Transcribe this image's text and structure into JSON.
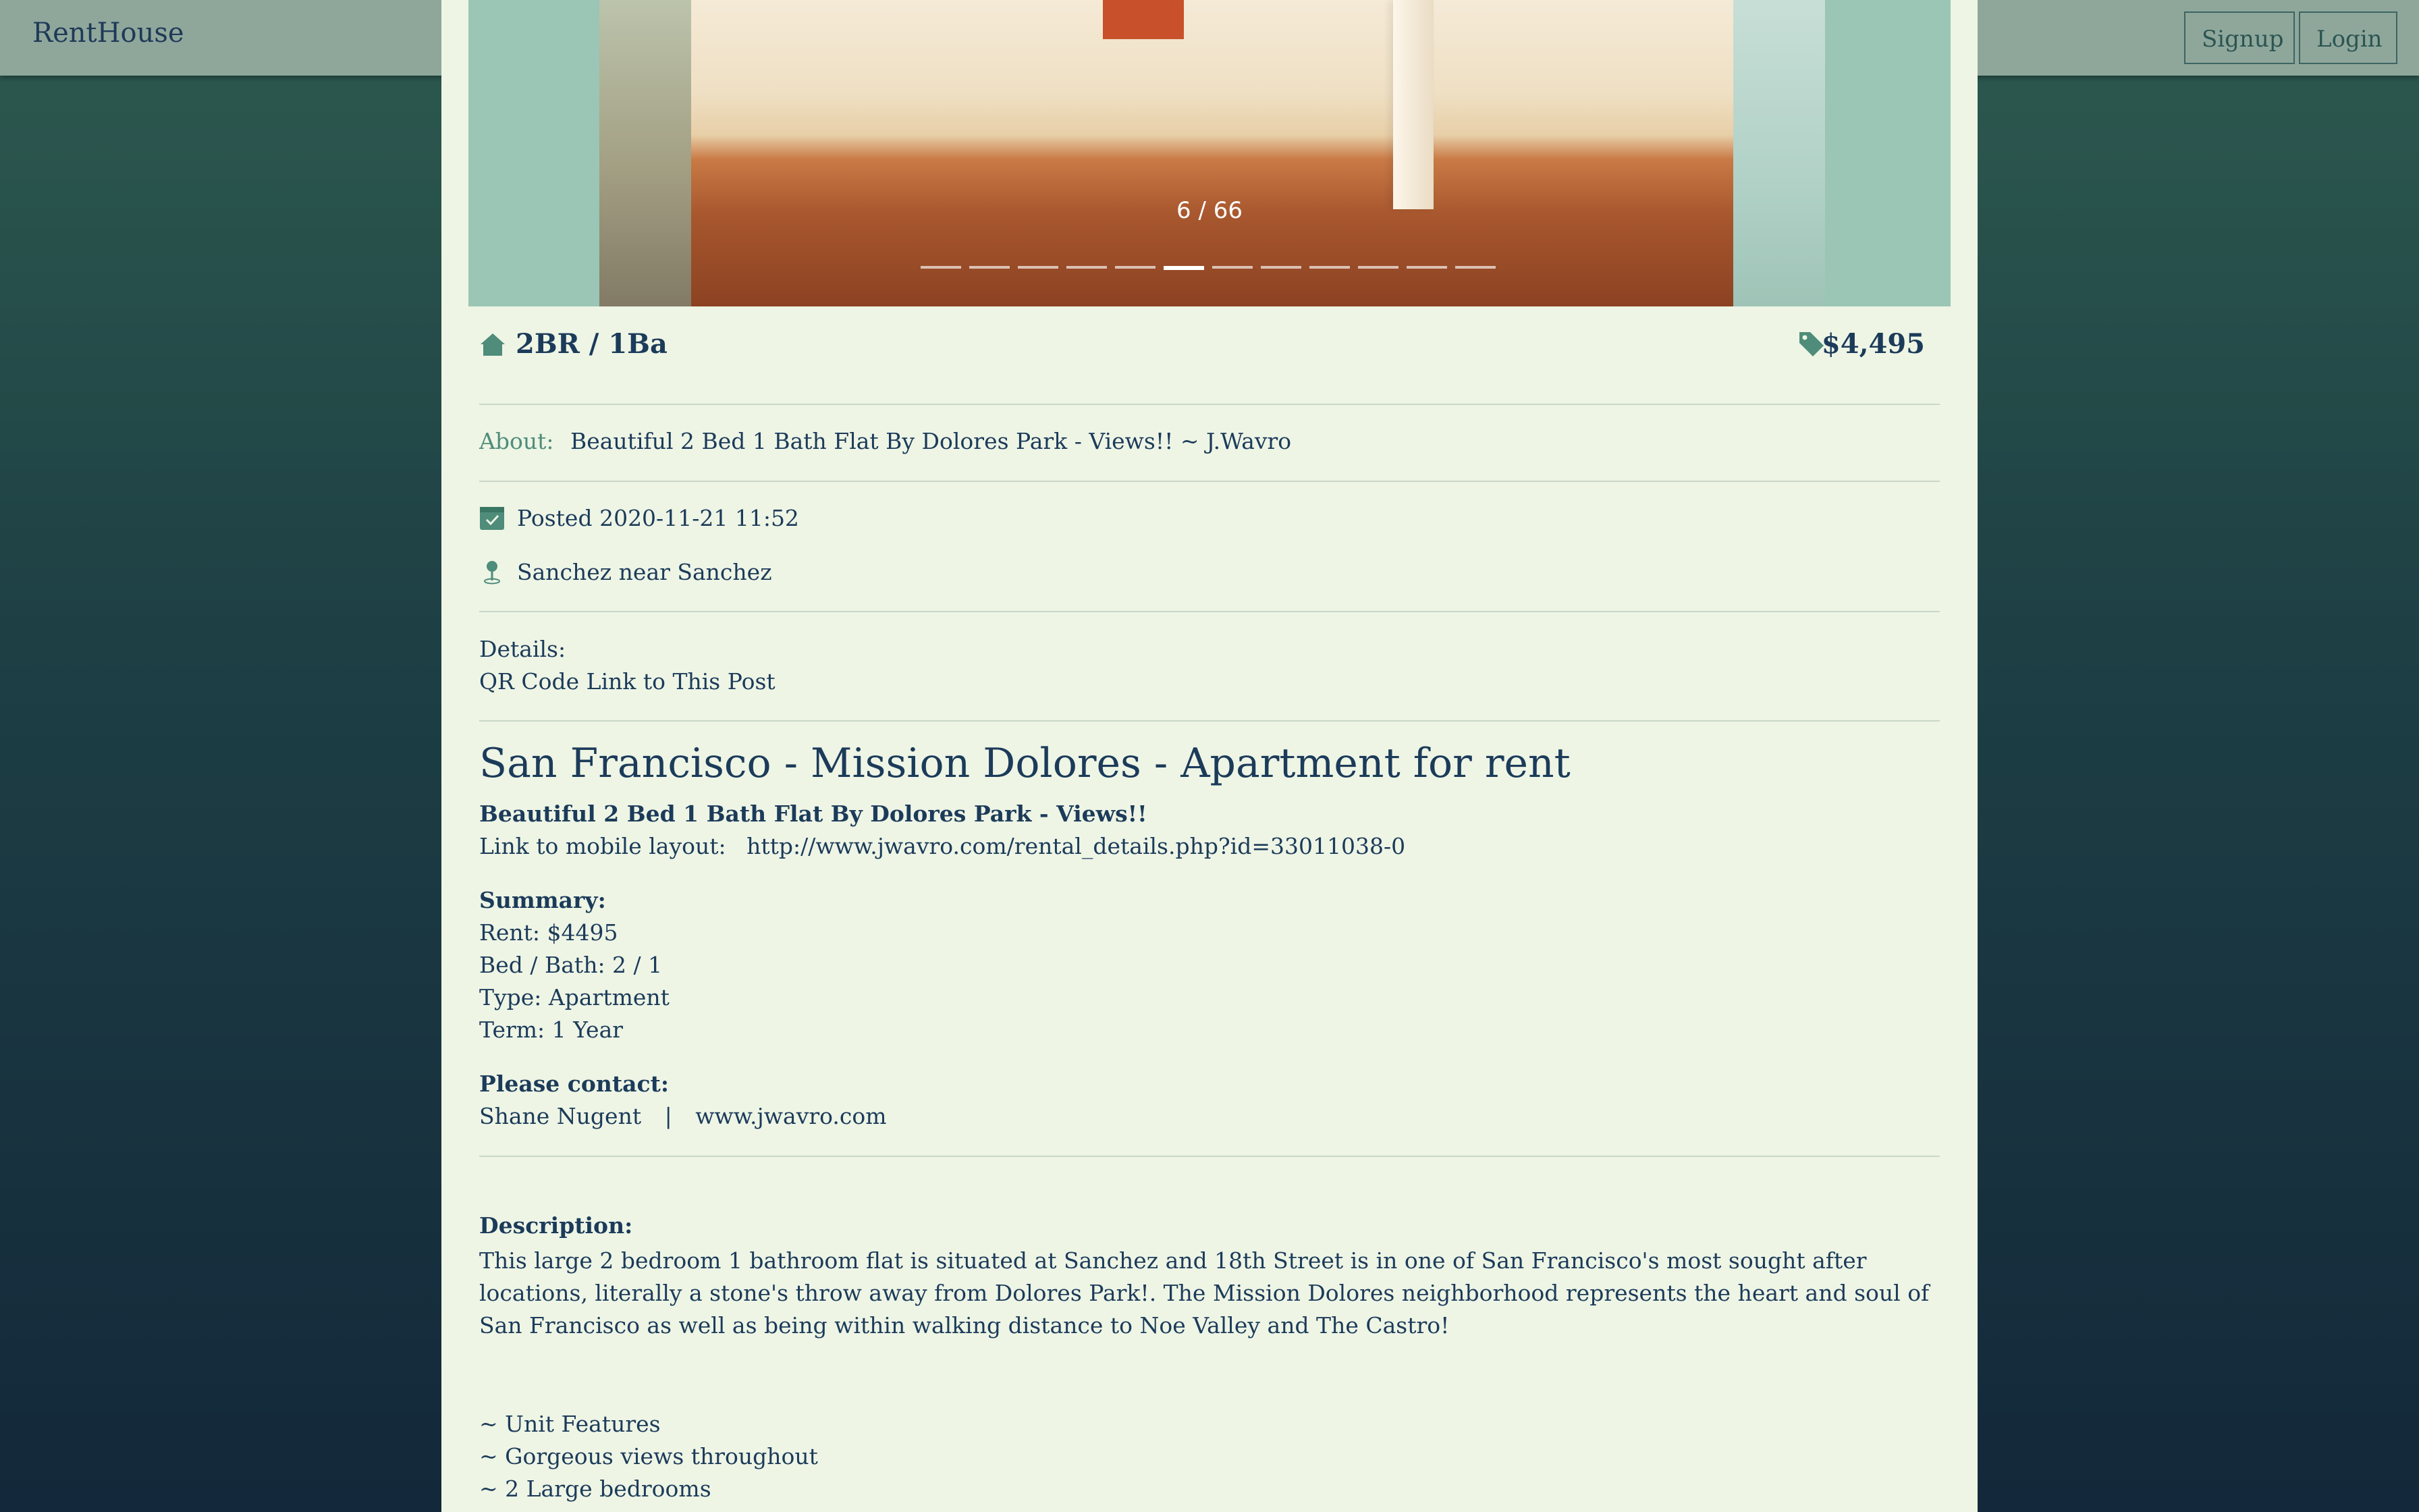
{
  "header": {
    "brand": "RentHouse",
    "signup": "Signup",
    "login": "Login"
  },
  "gallery": {
    "counter": "6 / 66",
    "total_dots": 12,
    "active_dot_index": 5
  },
  "listing": {
    "beds_baths": "2BR / 1Ba",
    "price": "$4,495",
    "about_label": "About:",
    "about_text": "Beautiful 2 Bed 1 Bath Flat By Dolores Park - Views!! ~ J.Wavro",
    "posted": "Posted 2020-11-21 11:52",
    "location": "Sanchez near Sanchez",
    "details_label": "Details:",
    "qr_link": "QR Code Link to This Post",
    "title": "San Francisco - Mission Dolores - Apartment for rent",
    "subtitle": "Beautiful 2 Bed 1 Bath Flat By Dolores Park - Views!!",
    "mobile_label": "Link to mobile layout:",
    "mobile_url": "http://www.jwavro.com/rental_details.php?id=33011038-0",
    "summary_label": "Summary:",
    "summary": [
      "Rent: $4495",
      "Bed / Bath: 2 / 1",
      "Type: Apartment",
      "Term: 1 Year"
    ],
    "contact_label": "Please contact:",
    "contact_name": "Shane Nugent",
    "contact_sep": "|",
    "contact_site": "www.jwavro.com",
    "description_label": "Description:",
    "description": "This large 2 bedroom 1 bathroom flat is situated at Sanchez and 18th Street is in one of San Francisco's most sought after locations, literally a stone's throw away from Dolores Park!.  The Mission Dolores neighborhood represents the heart and soul of San Francisco as well as being within walking distance to Noe Valley and The Castro!",
    "features": [
      "~ Unit Features",
      "~  Gorgeous views throughout",
      "~ 2 Large bedrooms"
    ]
  }
}
